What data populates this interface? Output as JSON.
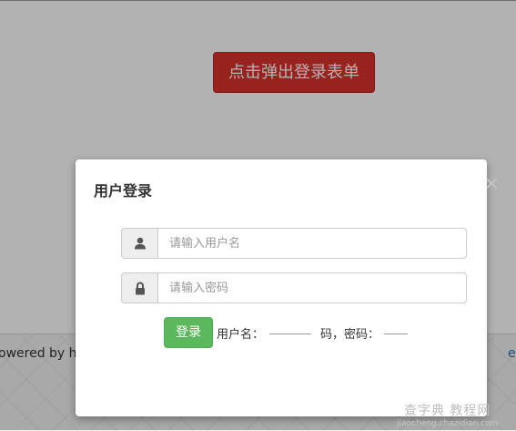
{
  "page": {
    "open_button_label": "点击弹出登录表单",
    "footer_text": "owered by h",
    "footer_right_text": "e"
  },
  "modal": {
    "title": "用户登录",
    "close_glyph": "×",
    "username_placeholder": "请输入用户名",
    "password_placeholder": "请输入密码",
    "login_label": "登录",
    "hint_user_label": "用户名：",
    "hint_pass_label": "码，密码：",
    "icons": {
      "username": "user-icon",
      "password": "lock-icon",
      "close": "close-icon"
    }
  },
  "watermark": {
    "line1": "查字典 教程网",
    "line2": "jiaocheng.chazidian.com"
  },
  "colors": {
    "open_button": "#d9322c",
    "login_button": "#5cb85c",
    "addon_bg": "#eeeeee"
  }
}
